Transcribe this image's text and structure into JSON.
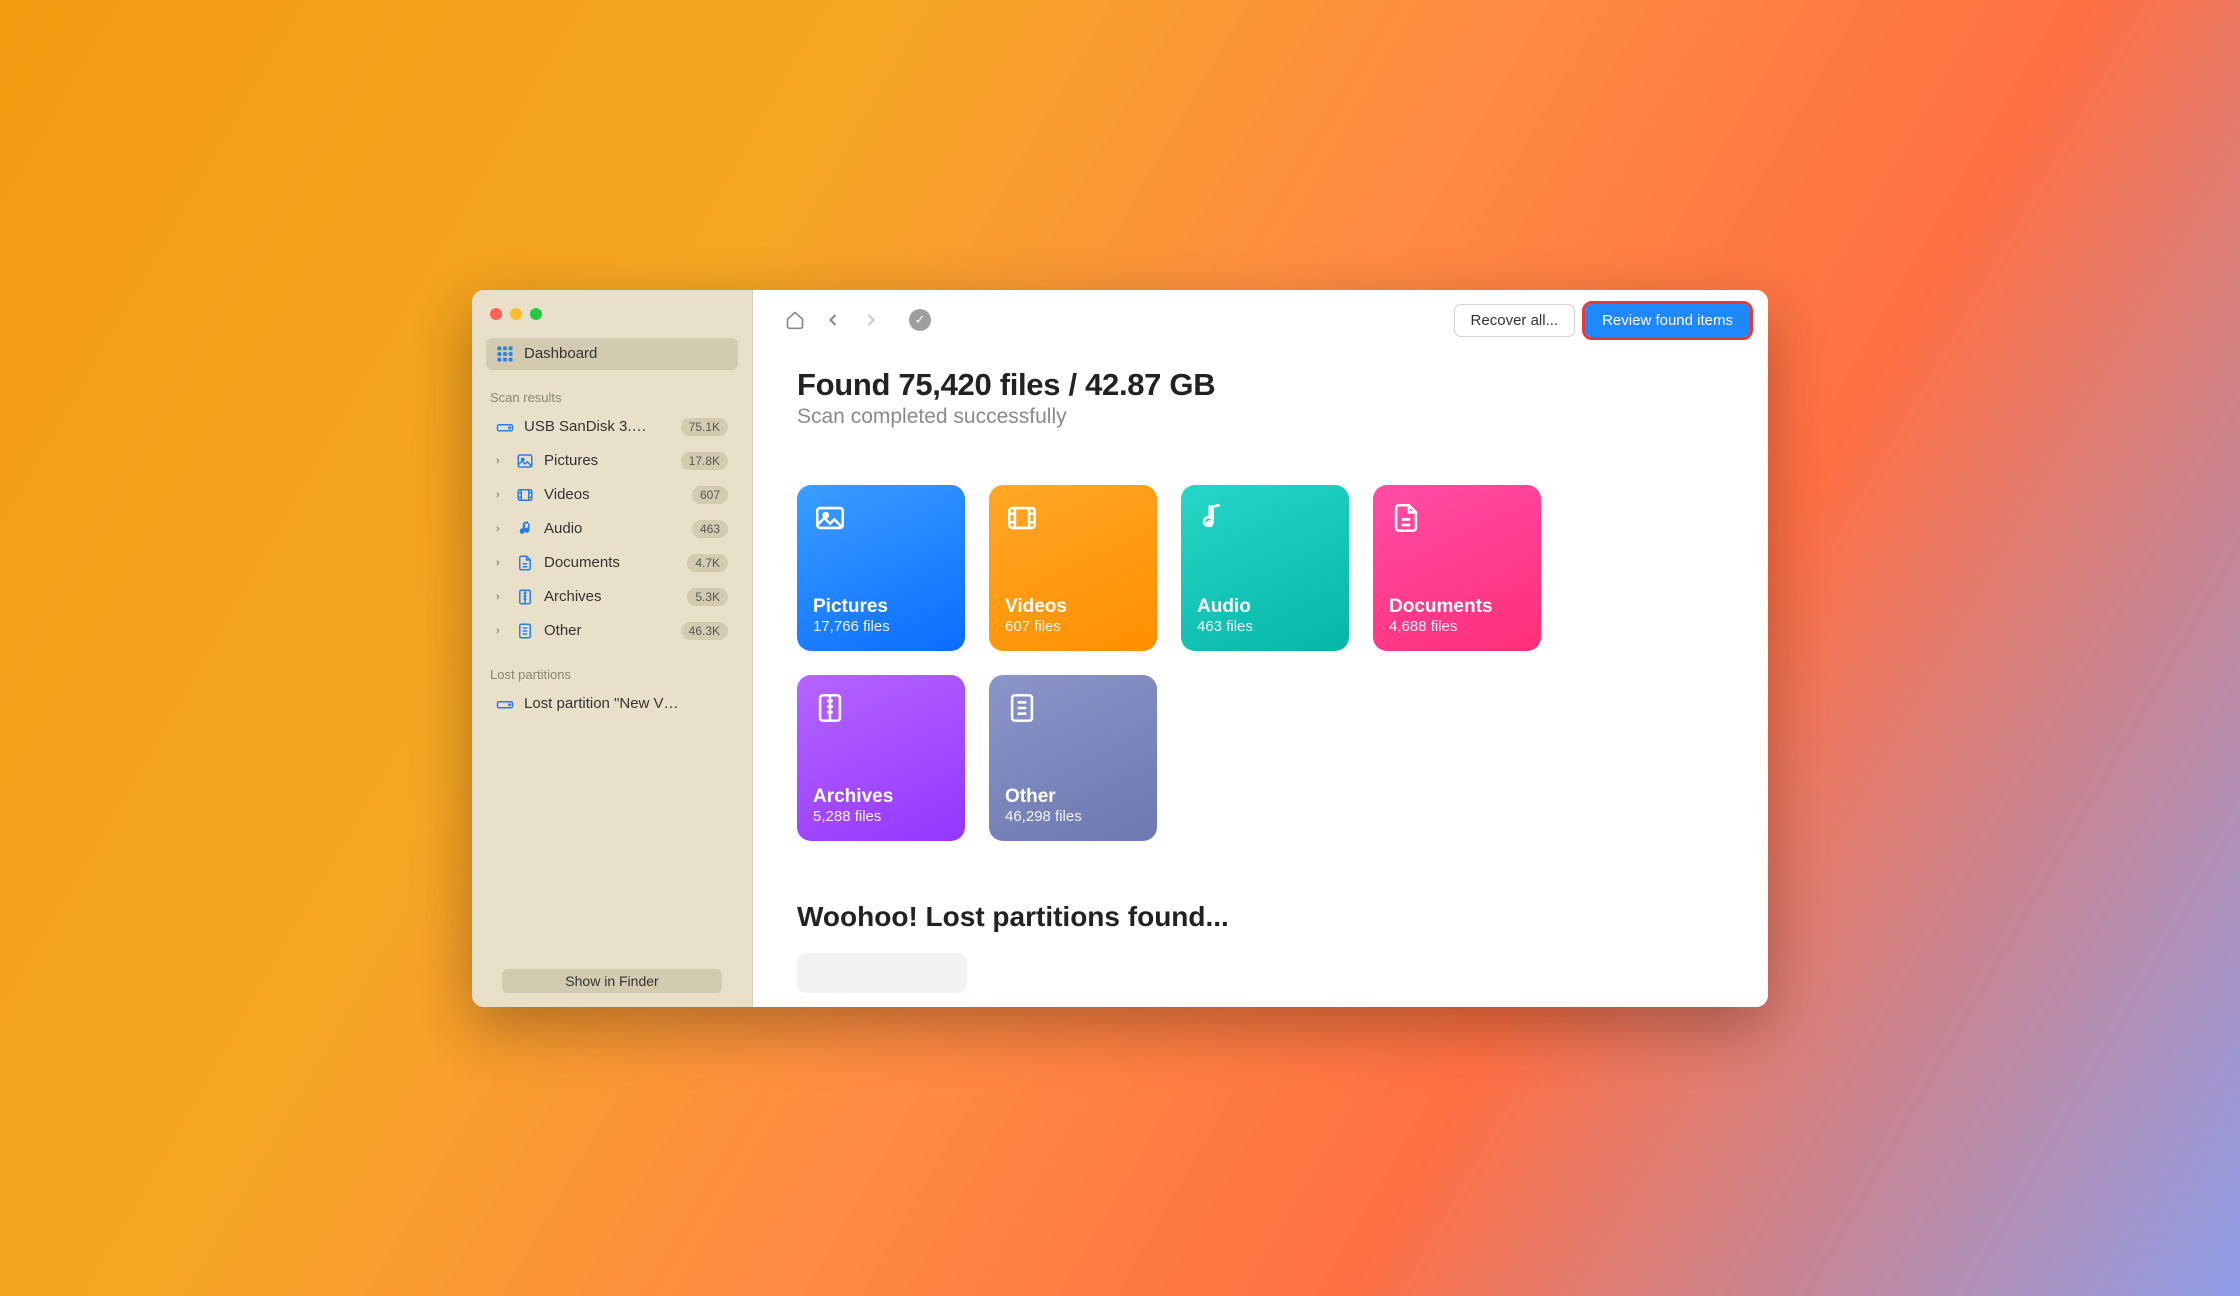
{
  "sidebar": {
    "dashboard_label": "Dashboard",
    "section_scan": "Scan results",
    "section_lost": "Lost partitions",
    "drive": {
      "label": "USB  SanDisk 3.…",
      "badge": "75.1K"
    },
    "categories": [
      {
        "label": "Pictures",
        "badge": "17.8K"
      },
      {
        "label": "Videos",
        "badge": "607"
      },
      {
        "label": "Audio",
        "badge": "463"
      },
      {
        "label": "Documents",
        "badge": "4.7K"
      },
      {
        "label": "Archives",
        "badge": "5.3K"
      },
      {
        "label": "Other",
        "badge": "46.3K"
      }
    ],
    "lost_partition_label": "Lost partition \"New V…",
    "show_in_finder": "Show in Finder"
  },
  "toolbar": {
    "recover_all": "Recover all...",
    "review": "Review found items"
  },
  "summary": {
    "title": "Found 75,420 files / 42.87 GB",
    "subtitle": "Scan completed successfully"
  },
  "cards": [
    {
      "title": "Pictures",
      "sub": "17,766 files"
    },
    {
      "title": "Videos",
      "sub": "607 files"
    },
    {
      "title": "Audio",
      "sub": "463 files"
    },
    {
      "title": "Documents",
      "sub": "4,688 files"
    },
    {
      "title": "Archives",
      "sub": "5,288 files"
    },
    {
      "title": "Other",
      "sub": "46,298 files"
    }
  ],
  "woohoo": "Woohoo! Lost partitions found..."
}
